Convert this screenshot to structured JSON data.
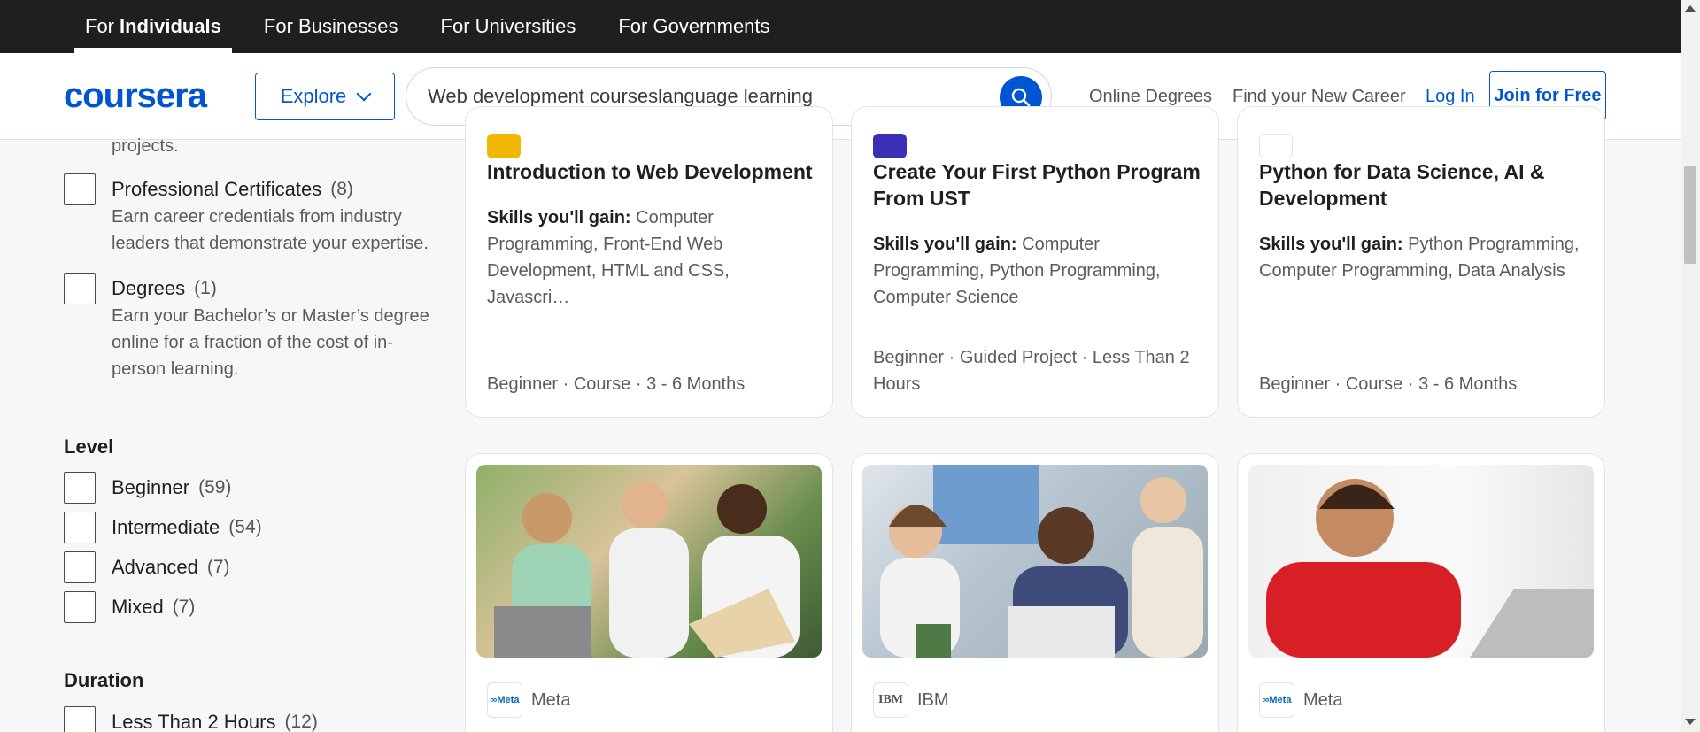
{
  "audience_tabs": [
    {
      "prefix": "For",
      "label": "Individuals",
      "active": true
    },
    {
      "label": "For Businesses"
    },
    {
      "label": "For Universities"
    },
    {
      "label": "For Governments"
    }
  ],
  "header": {
    "logo": "coursera",
    "explore_label": "Explore",
    "search_value": "Web development courseslanguage learning",
    "nav": [
      "Online Degrees",
      "Find your New Career",
      "Log In"
    ],
    "join_label": "Join for Free"
  },
  "sidebar": {
    "top_desc_tail": "projects.",
    "learning_products": [
      {
        "label": "Professional Certificates",
        "count": "(8)",
        "desc": "Earn career credentials from industry leaders that demonstrate your expertise."
      },
      {
        "label": "Degrees",
        "count": "(1)",
        "desc": "Earn your Bachelor’s or Master’s degree online for a fraction of the cost of in-person learning."
      }
    ],
    "level_title": "Level",
    "levels": [
      {
        "label": "Beginner",
        "count": "(59)"
      },
      {
        "label": "Intermediate",
        "count": "(54)"
      },
      {
        "label": "Advanced",
        "count": "(7)"
      },
      {
        "label": "Mixed",
        "count": "(7)"
      }
    ],
    "duration_title": "Duration",
    "durations": [
      {
        "label": "Less Than 2 Hours",
        "count": "(12)"
      }
    ]
  },
  "cards_row1": [
    {
      "title": "Introduction to Web Development",
      "skills_label": "Skills you'll gain:",
      "skills": "Computer Programming, Front-End Web Development, HTML and CSS, Javascri…",
      "meta": "Beginner · Course · 3 - 6 Months",
      "chip_color": "#f2b705"
    },
    {
      "title": "Create Your First Python Program From UST",
      "skills_label": "Skills you'll gain:",
      "skills": "Computer Programming, Python Programming, Computer Science",
      "meta": "Beginner · Guided Project · Less Than 2 Hours",
      "chip_color": "#3b2fb5"
    },
    {
      "title": "Python for Data Science, AI & Development",
      "skills_label": "Skills you'll gain:",
      "skills": "Python Programming, Computer Programming, Data Analysis",
      "meta": "Beginner · Course · 3 - 6 Months",
      "chip_color": "#ffffff"
    }
  ],
  "cards_row2": [
    {
      "partner": "Meta",
      "partner_logo": "∞Meta"
    },
    {
      "partner": "IBM",
      "partner_logo": "IBM"
    },
    {
      "partner": "Meta",
      "partner_logo": "∞Meta"
    }
  ],
  "colors": {
    "brand": "#0056d2",
    "topbar": "#1f1f1f"
  }
}
